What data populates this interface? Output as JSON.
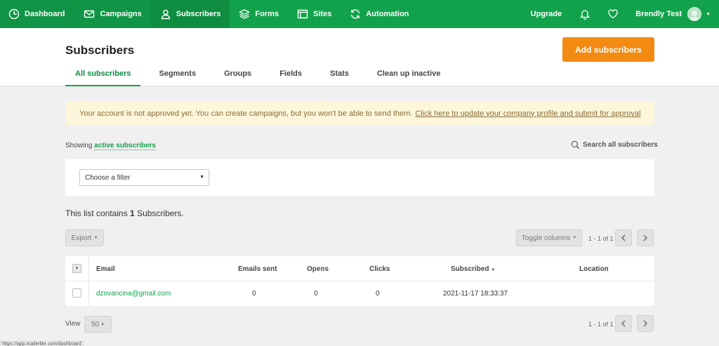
{
  "nav": {
    "items": [
      {
        "label": "Dashboard",
        "icon": "dashboard-icon"
      },
      {
        "label": "Campaigns",
        "icon": "envelope-icon"
      },
      {
        "label": "Subscribers",
        "icon": "user-icon"
      },
      {
        "label": "Forms",
        "icon": "layers-icon"
      },
      {
        "label": "Sites",
        "icon": "browser-icon"
      },
      {
        "label": "Automation",
        "icon": "refresh-icon"
      }
    ],
    "upgrade": "Upgrade",
    "user_name": "Brendly Test"
  },
  "header": {
    "title": "Subscribers",
    "add_button": "Add subscribers",
    "tabs": [
      "All subscribers",
      "Segments",
      "Groups",
      "Fields",
      "Stats",
      "Clean up inactive"
    ]
  },
  "alert": {
    "text": "Your account is not approved yet. You can create campaigns, but you won't be able to send them.",
    "link": "Click here to update your company profile and submit for approval"
  },
  "showing": {
    "prefix": "Showing",
    "link": "active subscribers",
    "search": "Search all subscribers"
  },
  "filter": {
    "placeholder": "Choose a filter"
  },
  "list": {
    "prefix": "This list contains",
    "count": "1",
    "suffix": "Subscribers."
  },
  "toolbar": {
    "export": "Export",
    "toggle_columns": "Toggle columns",
    "pager": "1 - 1 of 1"
  },
  "table": {
    "columns": [
      "Email",
      "Emails sent",
      "Opens",
      "Clicks",
      "Subscribed",
      "Location"
    ],
    "rows": [
      {
        "email": "dzovancina@gmail.com",
        "emails_sent": "0",
        "opens": "0",
        "clicks": "0",
        "subscribed": "2021-11-17 18:33:37",
        "location": ""
      }
    ]
  },
  "footer": {
    "view_label": "View",
    "page_size": "50",
    "pager": "1 - 1 of 1"
  },
  "status_url": "https://app.mailerlite.com/dashboard",
  "colors": {
    "nav_green": "#12a24b",
    "accent_orange": "#f38a12",
    "alert_bg": "#fdf6da"
  }
}
